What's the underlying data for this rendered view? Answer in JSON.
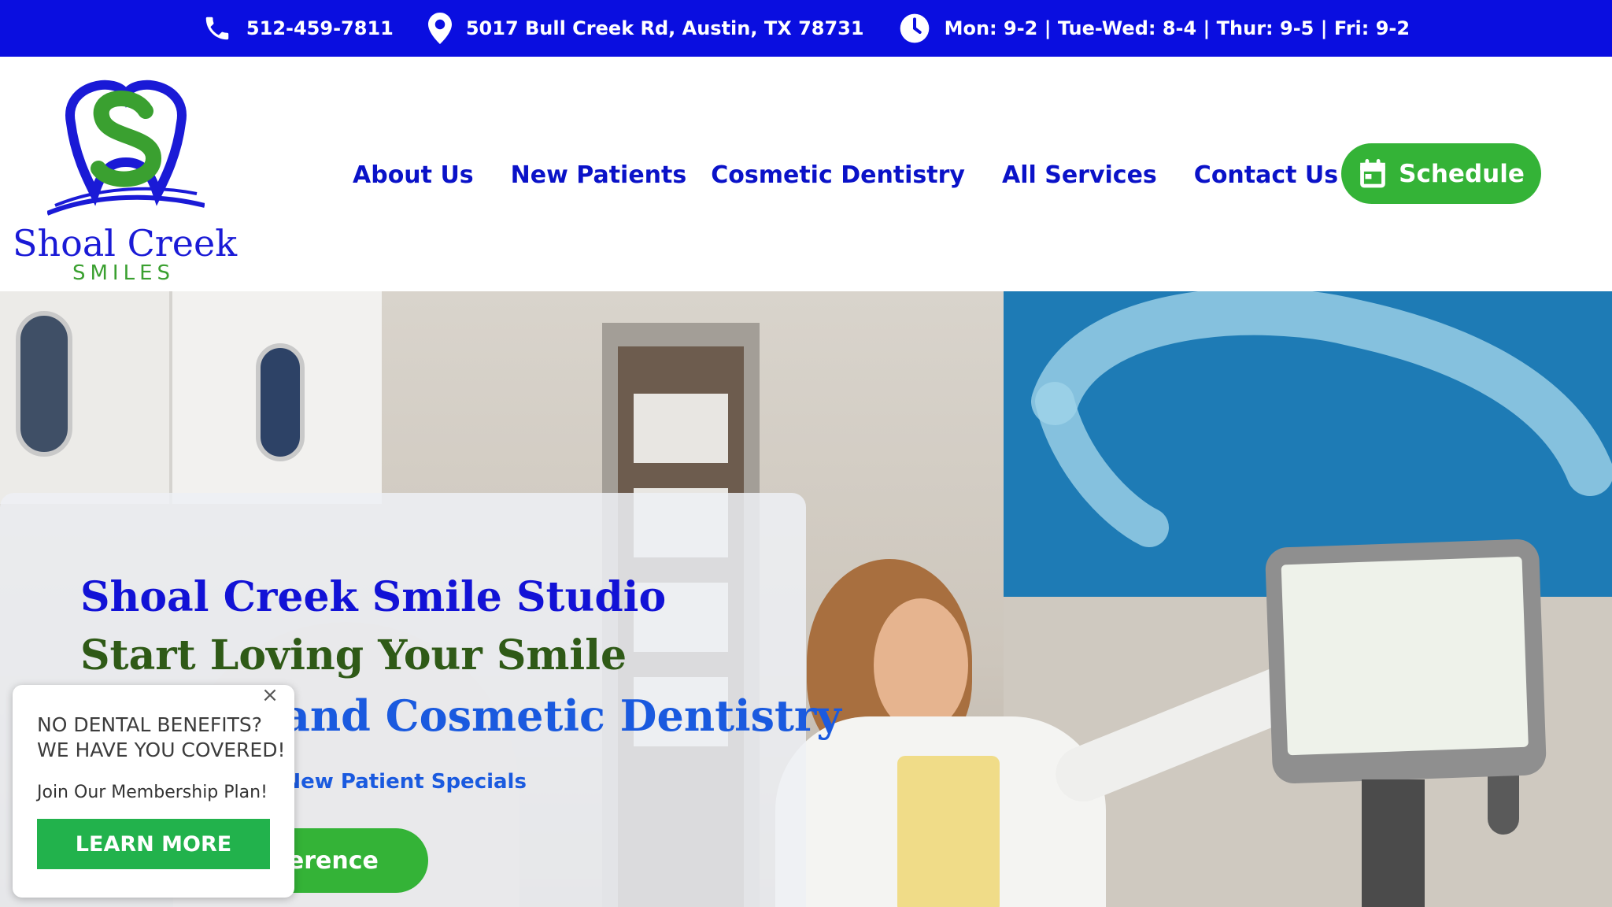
{
  "topbar": {
    "phone": "512-459-7811",
    "address": "5017 Bull Creek Rd, Austin, TX 78731",
    "hours": "Mon: 9-2 | Tue-Wed: 8-4 | Thur: 9-5 | Fri: 9-2",
    "icons": [
      "phone-icon",
      "map-pin-icon",
      "clock-icon"
    ]
  },
  "brand": {
    "name": "Shoal Creek",
    "tagline": "SMILES",
    "colors": {
      "primary_blue": "#0a0ee0",
      "green": "#34b337",
      "logo_green": "#3aa030"
    }
  },
  "nav": {
    "items": [
      "About Us",
      "New Patients",
      "Cosmetic Dentistry",
      "All Services",
      "Contact Us"
    ],
    "schedule_label": "Schedule"
  },
  "hero": {
    "title1": "Shoal Creek Smile Studio",
    "title2": "Start Loving Your Smile",
    "title3": "General and Cosmetic Dentistry",
    "link": "View our Current New Patient Specials",
    "button": "See the Difference"
  },
  "popup": {
    "heading_line1": "NO DENTAL BENEFITS?",
    "heading_line2": "WE HAVE YOU COVERED!",
    "text": "Join Our Membership Plan!",
    "button": "LEARN MORE",
    "close": "×"
  }
}
